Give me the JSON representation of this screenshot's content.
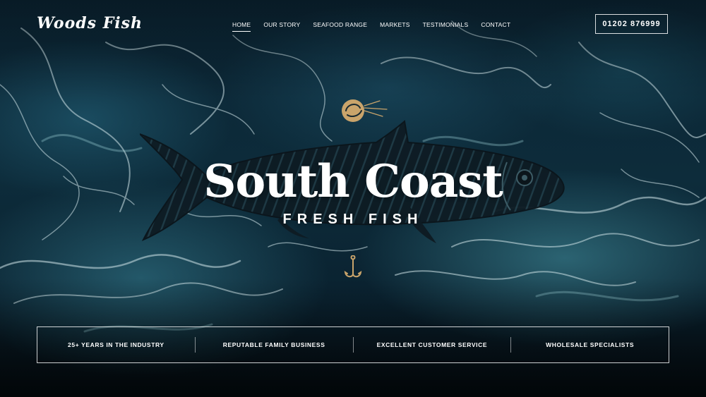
{
  "brand": {
    "logo_text": "Woods Fish"
  },
  "nav": {
    "items": [
      {
        "label": "HOME",
        "active": true
      },
      {
        "label": "OUR STORY"
      },
      {
        "label": "SEAFOOD RANGE"
      },
      {
        "label": "MARKETS"
      },
      {
        "label": "TESTIMONIALS"
      },
      {
        "label": "CONTACT"
      }
    ]
  },
  "header": {
    "phone": "01202 876999"
  },
  "hero": {
    "title": "South Coast",
    "subtitle": "FRESH FISH",
    "shrimp_icon": "shrimp-icon",
    "fish_illustration": "mackerel-illustration",
    "hook_icon": "fishing-hook-icon"
  },
  "features": [
    "25+ YEARS IN THE INDUSTRY",
    "REPUTABLE FAMILY BUSINESS",
    "EXCELLENT CUSTOMER SERVICE",
    "WHOLESALE SPECIALISTS"
  ],
  "colors": {
    "gold": "#c9a46b",
    "fish_dark": "#0e1c24",
    "ocean_deep": "#0b2433",
    "foam": "#dbe9ec"
  }
}
